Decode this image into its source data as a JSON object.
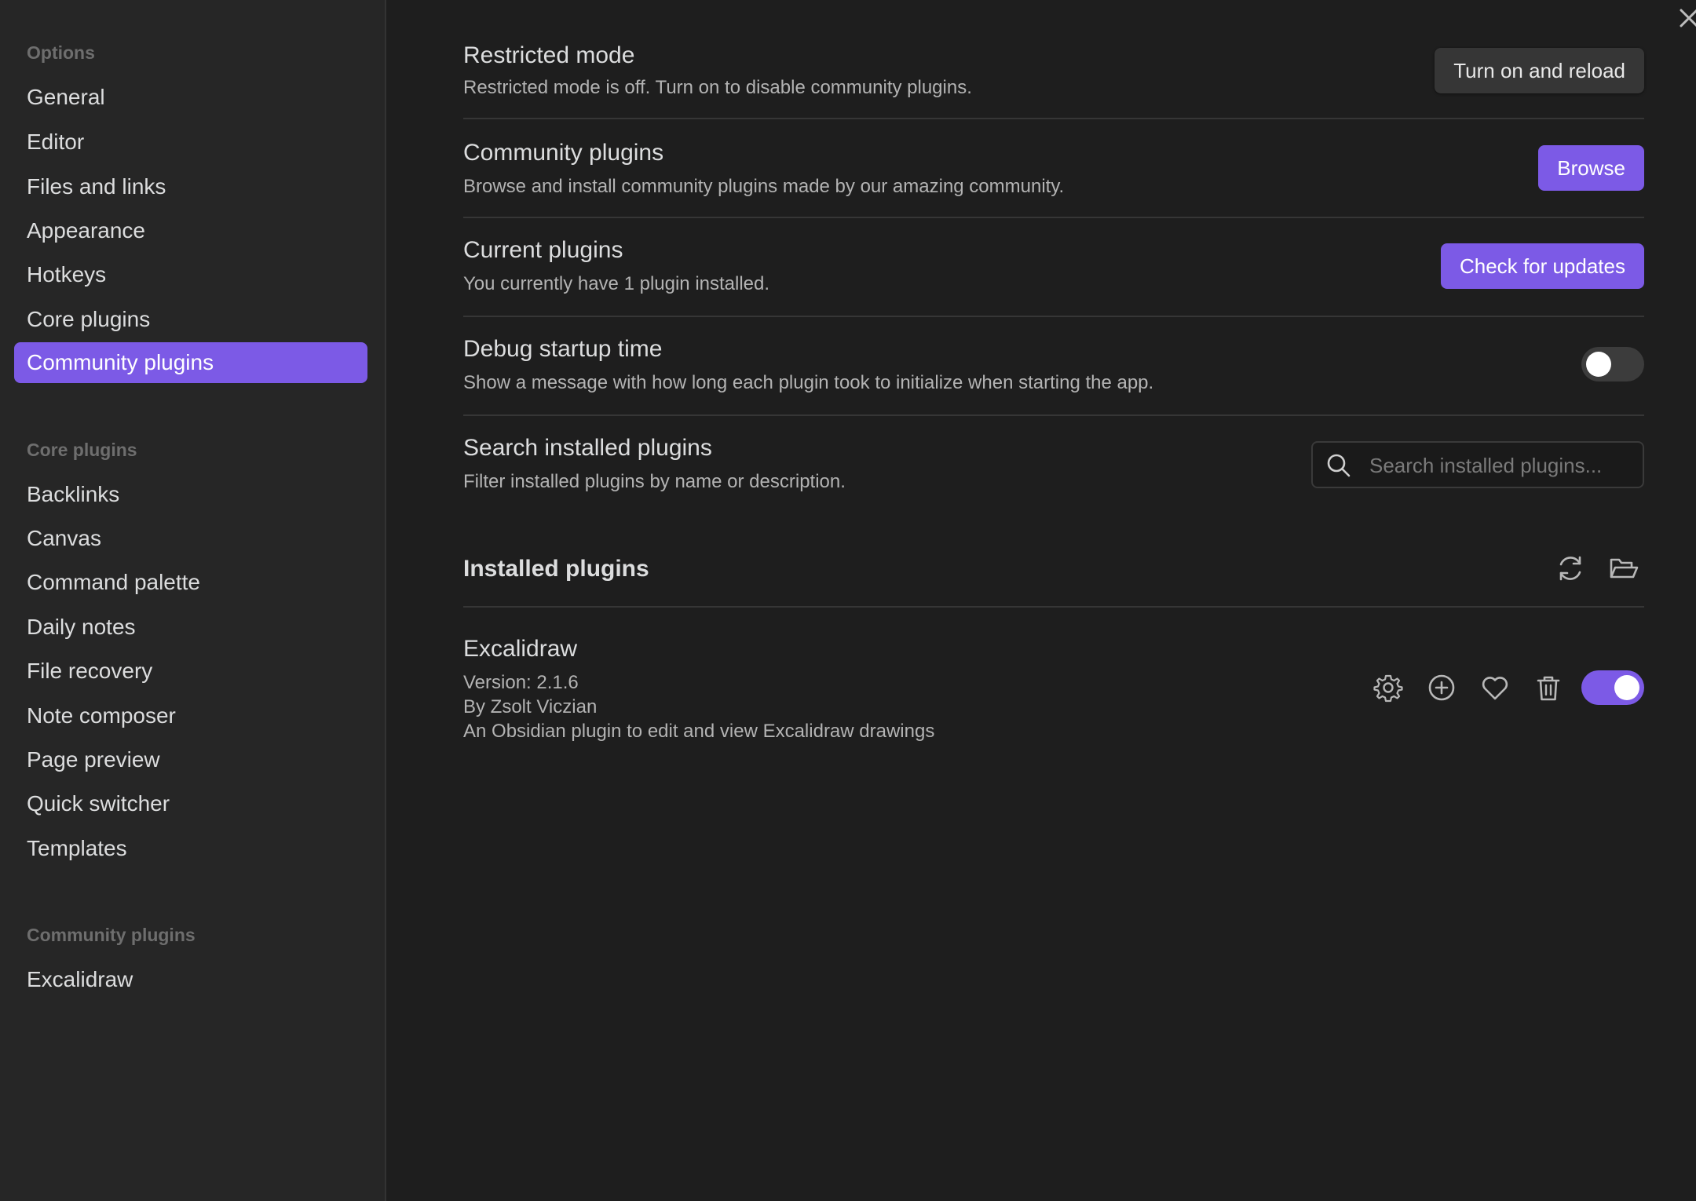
{
  "sidebar": {
    "options_title": "Options",
    "options_items": [
      {
        "label": "General"
      },
      {
        "label": "Editor"
      },
      {
        "label": "Files and links"
      },
      {
        "label": "Appearance"
      },
      {
        "label": "Hotkeys"
      },
      {
        "label": "Core plugins"
      },
      {
        "label": "Community plugins",
        "active": true
      }
    ],
    "core_title": "Core plugins",
    "core_items": [
      {
        "label": "Backlinks"
      },
      {
        "label": "Canvas"
      },
      {
        "label": "Command palette"
      },
      {
        "label": "Daily notes"
      },
      {
        "label": "File recovery"
      },
      {
        "label": "Note composer"
      },
      {
        "label": "Page preview"
      },
      {
        "label": "Quick switcher"
      },
      {
        "label": "Templates"
      }
    ],
    "community_title": "Community plugins",
    "community_items": [
      {
        "label": "Excalidraw"
      }
    ]
  },
  "settings": {
    "restricted": {
      "name": "Restricted mode",
      "desc": "Restricted mode is off. Turn on to disable community plugins.",
      "button": "Turn on and reload"
    },
    "community": {
      "name": "Community plugins",
      "desc": "Browse and install community plugins made by our amazing community.",
      "button": "Browse"
    },
    "current": {
      "name": "Current plugins",
      "desc": "You currently have 1 plugin installed.",
      "button": "Check for updates"
    },
    "debug": {
      "name": "Debug startup time",
      "desc": "Show a message with how long each plugin took to initialize when starting the app.",
      "enabled": false
    },
    "search": {
      "name": "Search installed plugins",
      "desc": "Filter installed plugins by name or description.",
      "placeholder": "Search installed plugins...",
      "value": ""
    }
  },
  "installed": {
    "title": "Installed plugins",
    "plugins": [
      {
        "name": "Excalidraw",
        "version": "Version: 2.1.6",
        "author": "By Zsolt Viczian",
        "description": "An Obsidian plugin to edit and view Excalidraw drawings",
        "enabled": true
      }
    ]
  },
  "colors": {
    "accent": "#7c5ae6",
    "background": "#1e1e1e",
    "sidebar": "#262626"
  },
  "icons": {
    "close": "close-icon",
    "search": "search-icon",
    "reload": "reload-icon",
    "folder": "folder-open-icon",
    "gear": "gear-icon",
    "add": "plus-circle-icon",
    "heart": "heart-icon",
    "trash": "trash-icon"
  }
}
